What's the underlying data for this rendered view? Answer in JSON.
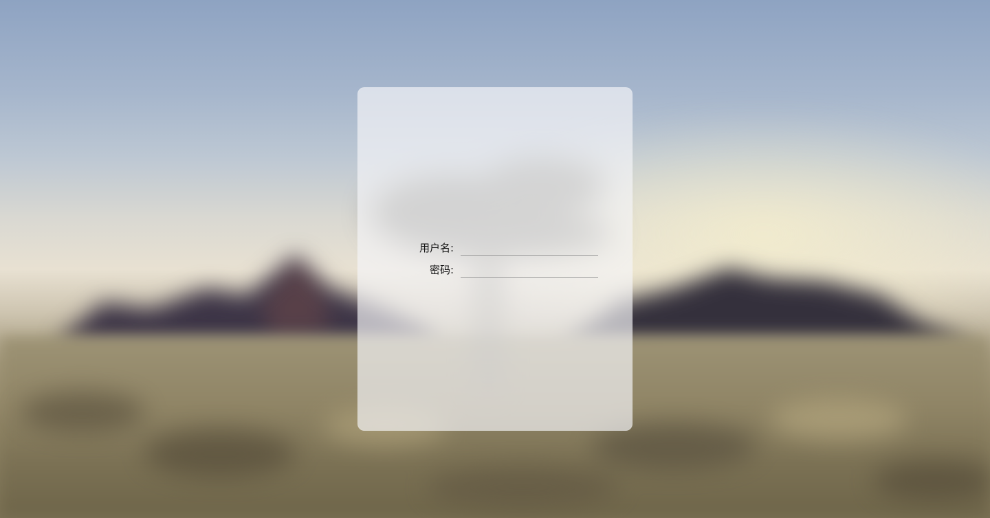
{
  "login": {
    "username_label": "用户名:",
    "username_value": "",
    "password_label": "密码:",
    "password_value": ""
  },
  "colors": {
    "sky_top": "#8ea3c2",
    "horizon": "#e8e1d2",
    "ground": "#8f8465",
    "card": "#f5f5f8"
  }
}
